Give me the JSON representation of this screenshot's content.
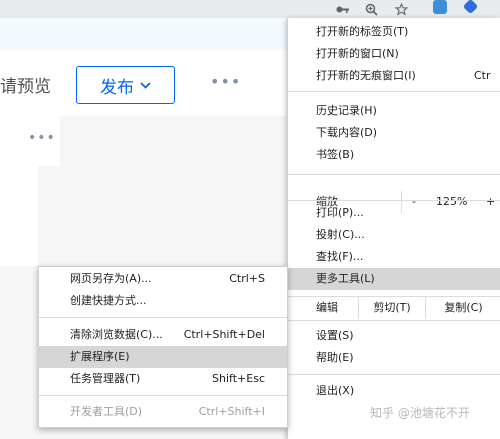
{
  "toolbar": {
    "icons": [
      "key-icon",
      "zoom-icon",
      "star-icon",
      "telegram-icon",
      "extension-icon"
    ]
  },
  "page": {
    "preview_text": "请预览",
    "publish_label": "发布",
    "more_label": "•••",
    "card_more_label": "•••"
  },
  "main_menu": {
    "items": [
      {
        "label": "打开新的标签页(T)",
        "shortcut": ""
      },
      {
        "label": "打开新的窗口(N)",
        "shortcut": ""
      },
      {
        "label": "打开新的无痕窗口(I)",
        "shortcut": "Ctr"
      },
      {
        "label": "历史记录(H)",
        "shortcut": ""
      },
      {
        "label": "下载内容(D)",
        "shortcut": ""
      },
      {
        "label": "书签(B)",
        "shortcut": ""
      },
      {
        "label": "打印(P)...",
        "shortcut": ""
      },
      {
        "label": "投射(C)...",
        "shortcut": ""
      },
      {
        "label": "查找(F)...",
        "shortcut": ""
      },
      {
        "label": "更多工具(L)",
        "shortcut": ""
      },
      {
        "label": "设置(S)",
        "shortcut": ""
      },
      {
        "label": "帮助(E)",
        "shortcut": ""
      },
      {
        "label": "退出(X)",
        "shortcut": ""
      }
    ],
    "zoom": {
      "label": "缩放",
      "minus": "-",
      "value": "125%",
      "plus": "+"
    },
    "edit": {
      "label": "编辑",
      "cut": "剪切(T)",
      "copy": "复制(C)"
    }
  },
  "sub_menu": {
    "items": [
      {
        "label": "网页另存为(A)...",
        "shortcut": "Ctrl+S"
      },
      {
        "label": "创建快捷方式...",
        "shortcut": ""
      },
      {
        "label": "清除浏览数据(C)...",
        "shortcut": "Ctrl+Shift+Del"
      },
      {
        "label": "扩展程序(E)",
        "shortcut": ""
      },
      {
        "label": "任务管理器(T)",
        "shortcut": "Shift+Esc"
      },
      {
        "label": "开发者工具(D)",
        "shortcut": "Ctrl+Shift+I"
      }
    ]
  },
  "watermark": "知乎 @池塘花不开",
  "colors": {
    "accent": "#0066ff",
    "highlight": "#d6d6d6",
    "banner": "#f2fbfd"
  }
}
